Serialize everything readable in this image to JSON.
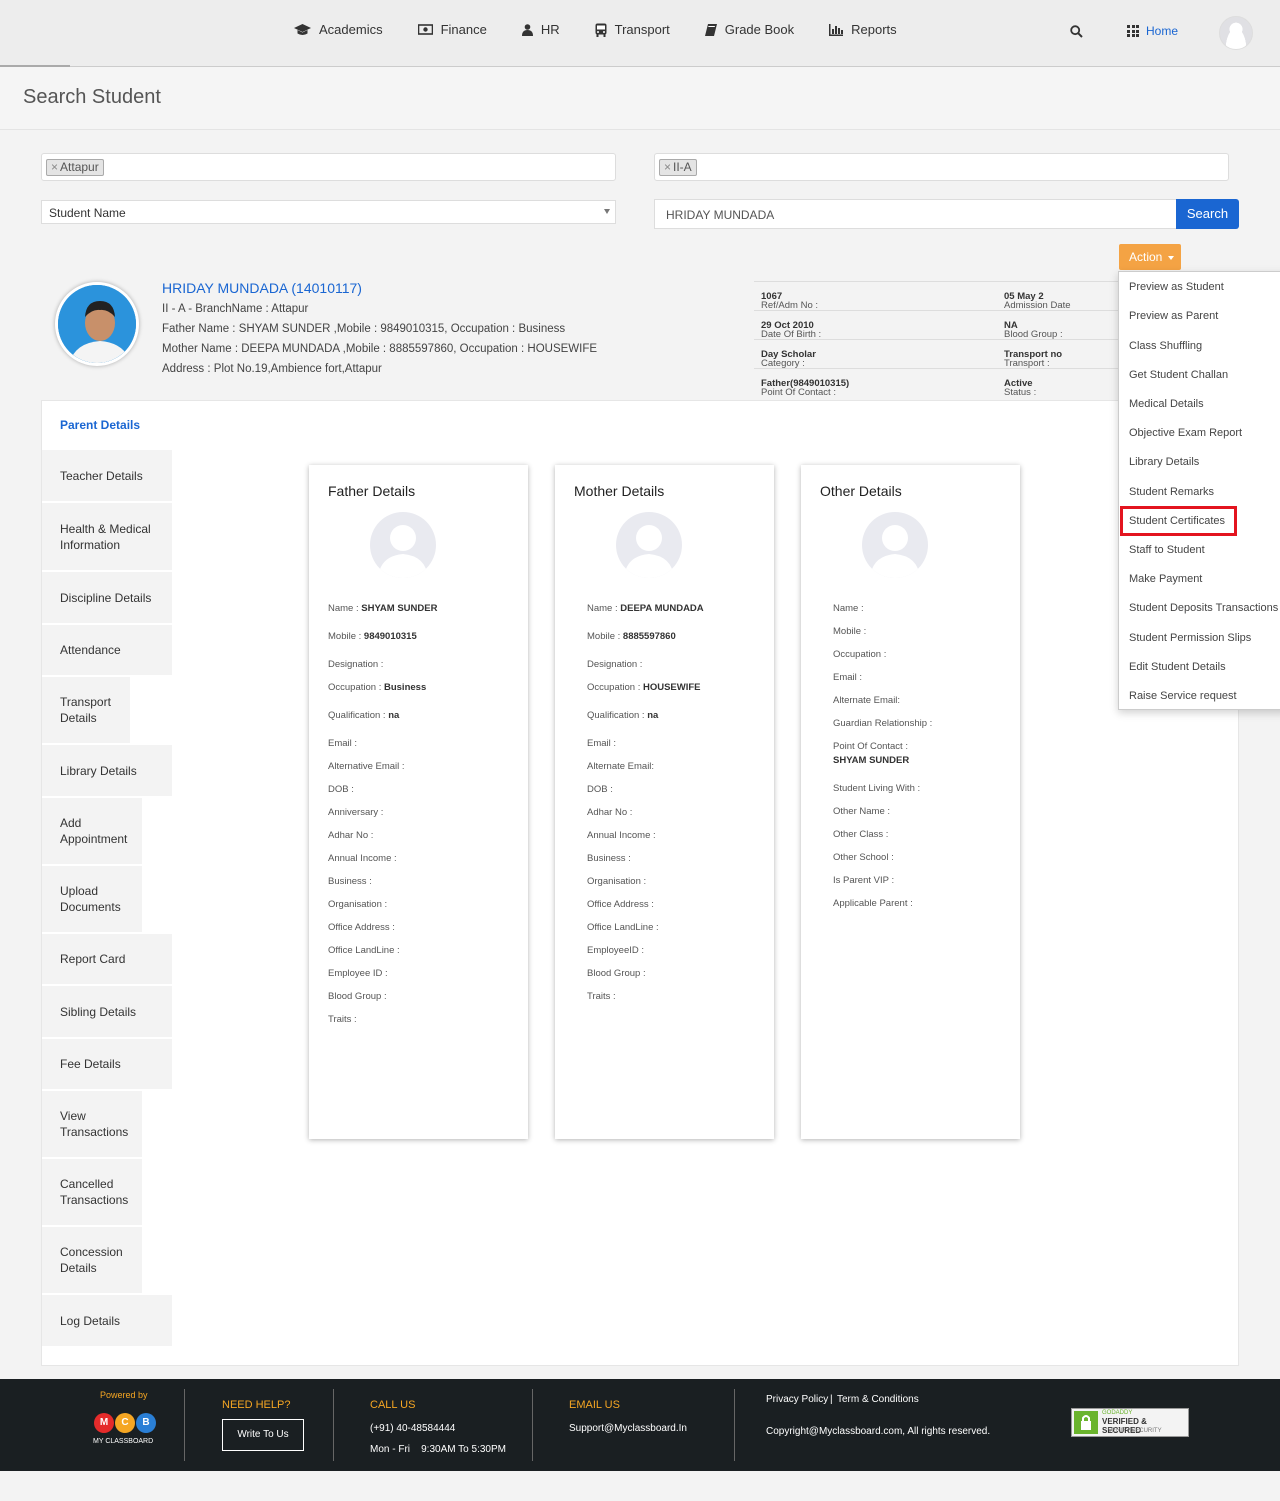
{
  "nav": {
    "items": [
      "Academics",
      "Finance",
      "HR",
      "Transport",
      "Grade Book",
      "Reports"
    ],
    "home": "Home"
  },
  "page_title": "Search Student",
  "filters": {
    "branch_chip": "Attapur",
    "class_chip": "II-A",
    "search_by": "Student Name",
    "search_value": "HRIDAY MUNDADA",
    "search_button": "Search"
  },
  "action_button": "Action",
  "student": {
    "name": "HRIDAY MUNDADA (14010117)",
    "class_branch": "II - A - BranchName : Attapur",
    "father": "Father Name : SHYAM SUNDER ,Mobile : 9849010315, Occupation : Business",
    "mother": "Mother Name : DEEPA MUNDADA ,Mobile : 8885597860, Occupation : HOUSEWIFE",
    "address": "Address : Plot No.19,Ambience fort,Attapur"
  },
  "info": [
    {
      "label": "Ref/Adm No :",
      "value": "1067",
      "label2": "Admission Date",
      "value2": "05 May 2"
    },
    {
      "label": "Date Of Birth :",
      "value": "29 Oct 2010",
      "label2": "Blood Group :",
      "value2": "NA"
    },
    {
      "label": "Category :",
      "value": "Day Scholar",
      "label2": "Transport :",
      "value2": "Transport no"
    },
    {
      "label": "Point Of Contact : ",
      "value": "Father(9849010315)",
      "label2": "Status :",
      "value2": "Active"
    }
  ],
  "sidebar": {
    "active": "Parent Details",
    "items": [
      "Teacher Details",
      "Health & Medical Information",
      "Discipline Details",
      "Attendance",
      "Transport Details",
      "Library Details",
      "Add Appointment",
      "Upload Documents",
      "Report Card",
      "Sibling Details",
      "Fee Details",
      "View Transactions",
      "Cancelled Transactions",
      "Concession Details",
      "Log Details"
    ]
  },
  "father_card": {
    "title": "Father Details",
    "fields": [
      {
        "label": "Name : ",
        "value": "SHYAM SUNDER"
      },
      {
        "label": "Mobile : ",
        "value": "9849010315"
      },
      {
        "label": "Designation : ",
        "value": ""
      },
      {
        "label": "Occupation : ",
        "value": "Business"
      },
      {
        "label": "Qualification : ",
        "value": "na"
      },
      {
        "label": "Email : ",
        "value": ""
      },
      {
        "label": "Alternative Email : ",
        "value": ""
      },
      {
        "label": "DOB : ",
        "value": ""
      },
      {
        "label": "Anniversary : ",
        "value": ""
      },
      {
        "label": "Adhar No : ",
        "value": ""
      },
      {
        "label": "Annual Income : ",
        "value": ""
      },
      {
        "label": "Business : ",
        "value": ""
      },
      {
        "label": "Organisation : ",
        "value": ""
      },
      {
        "label": "Office Address : ",
        "value": ""
      },
      {
        "label": "Office LandLine : ",
        "value": ""
      },
      {
        "label": "Employee ID : ",
        "value": ""
      },
      {
        "label": "Blood Group : ",
        "value": ""
      },
      {
        "label": "Traits : ",
        "value": ""
      }
    ]
  },
  "mother_card": {
    "title": "Mother Details",
    "fields": [
      {
        "label": "Name : ",
        "value": "DEEPA MUNDADA"
      },
      {
        "label": "Mobile : ",
        "value": "8885597860"
      },
      {
        "label": "Designation : ",
        "value": ""
      },
      {
        "label": "Occupation : ",
        "value": "HOUSEWIFE"
      },
      {
        "label": "Qualification : ",
        "value": "na"
      },
      {
        "label": "Email : ",
        "value": ""
      },
      {
        "label": "Alternate Email: ",
        "value": ""
      },
      {
        "label": "DOB : ",
        "value": ""
      },
      {
        "label": "Adhar No : ",
        "value": ""
      },
      {
        "label": "Annual Income : ",
        "value": ""
      },
      {
        "label": "Business : ",
        "value": ""
      },
      {
        "label": "Organisation : ",
        "value": ""
      },
      {
        "label": "Office Address : ",
        "value": ""
      },
      {
        "label": "Office LandLine : ",
        "value": ""
      },
      {
        "label": "EmployeeID : ",
        "value": ""
      },
      {
        "label": "Blood Group : ",
        "value": ""
      },
      {
        "label": "Traits : ",
        "value": ""
      }
    ]
  },
  "other_card": {
    "title": "Other Details",
    "fields": [
      "Name :",
      "Mobile :",
      "Occupation :",
      "Email :",
      "Alternate Email:",
      "Guardian Relationship :",
      "Point Of Contact :",
      "Student Living With :",
      "Other Name :",
      "Other Class :",
      "Other School :",
      "Is Parent VIP :",
      "Applicable Parent :"
    ],
    "point_of_contact_value": "SHYAM SUNDER"
  },
  "action_menu": [
    "Preview as Student",
    "Preview as Parent",
    "Class Shuffling",
    "Get Student Challan",
    "Medical Details",
    "Objective Exam Report",
    "Library Details",
    "Student Remarks",
    "Student Certificates",
    "Staff to Student",
    "Make Payment",
    "Student Deposits Transactions",
    "Student Permission Slips",
    "Edit Student Details",
    "Raise Service request"
  ],
  "footer": {
    "powered_by": "Powered by",
    "logo_text": "MY CLASSBOARD",
    "logo_letters": [
      "M",
      "C",
      "B"
    ],
    "need_help": "NEED HELP?",
    "write_to_us": "Write To Us",
    "call_us": "CALL US",
    "phone": "(+91) 40-48584444",
    "hours": "Mon - Fri    9:30AM To 5:30PM",
    "email_us": "EMAIL US",
    "email": "Support@Myclassboard.In",
    "privacy": "Privacy Policy",
    "terms": "Term & Conditions",
    "copyright": "Copyright@Myclassboard.com, All rights reserved.",
    "badge_top": "GODADDY",
    "badge_main": "VERIFIED & SECURED",
    "badge_sub": "VERIFY SECURITY"
  },
  "colors": {
    "primary": "#1a66d2",
    "action": "#f4a344",
    "highlight": "#e3141f",
    "footer_bg": "#1a1f22",
    "footer_heading": "#f6a623"
  }
}
